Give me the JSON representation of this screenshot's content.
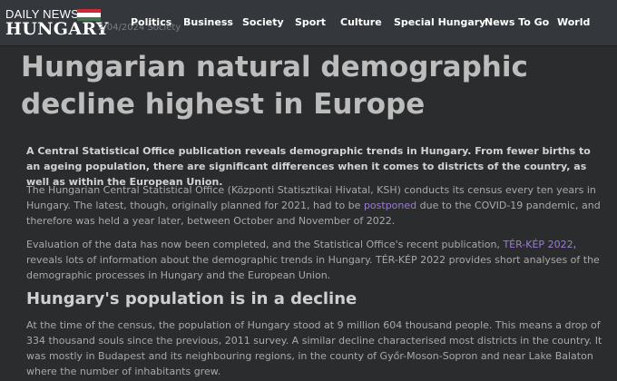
{
  "header": {
    "logo_line1": "DAILY NEWS",
    "logo_line2": "HUNGARY",
    "flag_colors": [
      "#ce2939",
      "#ffffff",
      "#477050"
    ],
    "meta": "2/04/2024 Society",
    "nav": [
      "Politics",
      "Business",
      "Society",
      "Sport",
      "Culture",
      "Special Hungary",
      "News To Go",
      "World"
    ]
  },
  "article": {
    "title": "Hungarian natural demographic decline highest in Europe",
    "lead": "A Central Statistical Office publication reveals demographic trends in Hungary. From fewer births to an ageing population, there are significant differences when it comes to districts of the country, as well as within the European Union.",
    "p1_before": "The Hungarian Central Statistical Office (Központi Statisztikai Hivatal, KSH) conducts its census every ten years in Hungary. The latest, though, originally planned for 2021, had to be ",
    "p1_link": "postponed",
    "p1_after": " due to the COVID-19 pandemic, and therefore was held a year later, between October and November of 2022.",
    "p2_before": "Evaluation of the data has now been completed, and the Statistical Office's recent publication, ",
    "p2_link": "TÉR-KÉP 2022",
    "p2_after": ", reveals lots of information about the demographic trends in Hungary. TÉR-KÉP 2022 provides short analyses of the demographic processes in Hungary and the European Union.",
    "h2": "Hungary's population is in a decline",
    "p3": "At the time of the census, the population of Hungary stood at 9 million 604 thousand people. This means a drop of 334 thousand souls since the previous, 2011 survey. A similar decline characterised most districts in the country. It was mostly in Budapest and its neighbouring regions, in the county of Győr-Moson-Sopron and near Lake Balaton where the number of inhabitants grew."
  }
}
